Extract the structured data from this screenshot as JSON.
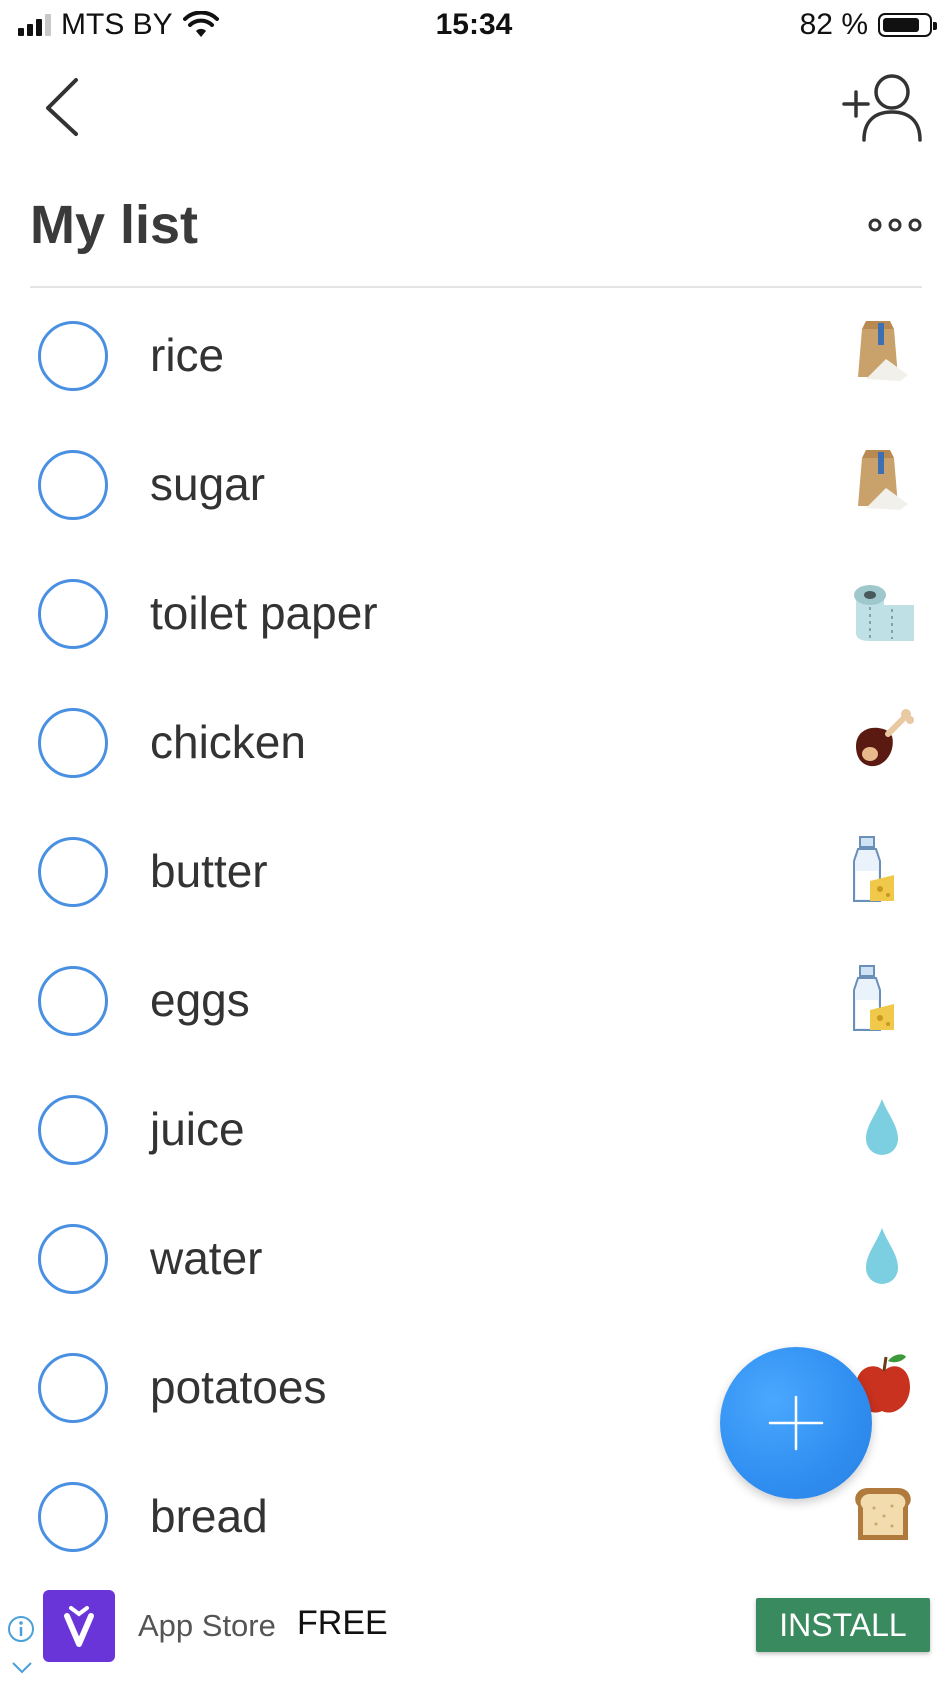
{
  "status_bar": {
    "carrier": "MTS BY",
    "time": "15:34",
    "battery_percent": "82 %",
    "battery_level": 0.82
  },
  "header": {
    "back_icon": "chevron-left-icon",
    "share_icon": "add-person-icon",
    "title": "My list",
    "more_icon": "more-dots-icon"
  },
  "list": {
    "items": [
      {
        "label": "rice",
        "icon": "grain-bag-icon"
      },
      {
        "label": "sugar",
        "icon": "grain-bag-icon"
      },
      {
        "label": "toilet paper",
        "icon": "paper-roll-icon"
      },
      {
        "label": "chicken",
        "icon": "meat-icon"
      },
      {
        "label": "butter",
        "icon": "dairy-icon"
      },
      {
        "label": "eggs",
        "icon": "dairy-icon"
      },
      {
        "label": "juice",
        "icon": "water-drop-icon"
      },
      {
        "label": "water",
        "icon": "water-drop-icon"
      },
      {
        "label": "potatoes",
        "icon": "apple-icon"
      },
      {
        "label": "bread",
        "icon": "bread-icon"
      }
    ]
  },
  "fab": {
    "icon": "plus-icon"
  },
  "ad": {
    "store": "App Store",
    "price": "FREE",
    "install_label": "INSTALL"
  },
  "colors": {
    "accent": "#4a90e2",
    "fab": "#2f8ef0",
    "install": "#3a8a5f",
    "ad_icon": "#6a35d8"
  }
}
